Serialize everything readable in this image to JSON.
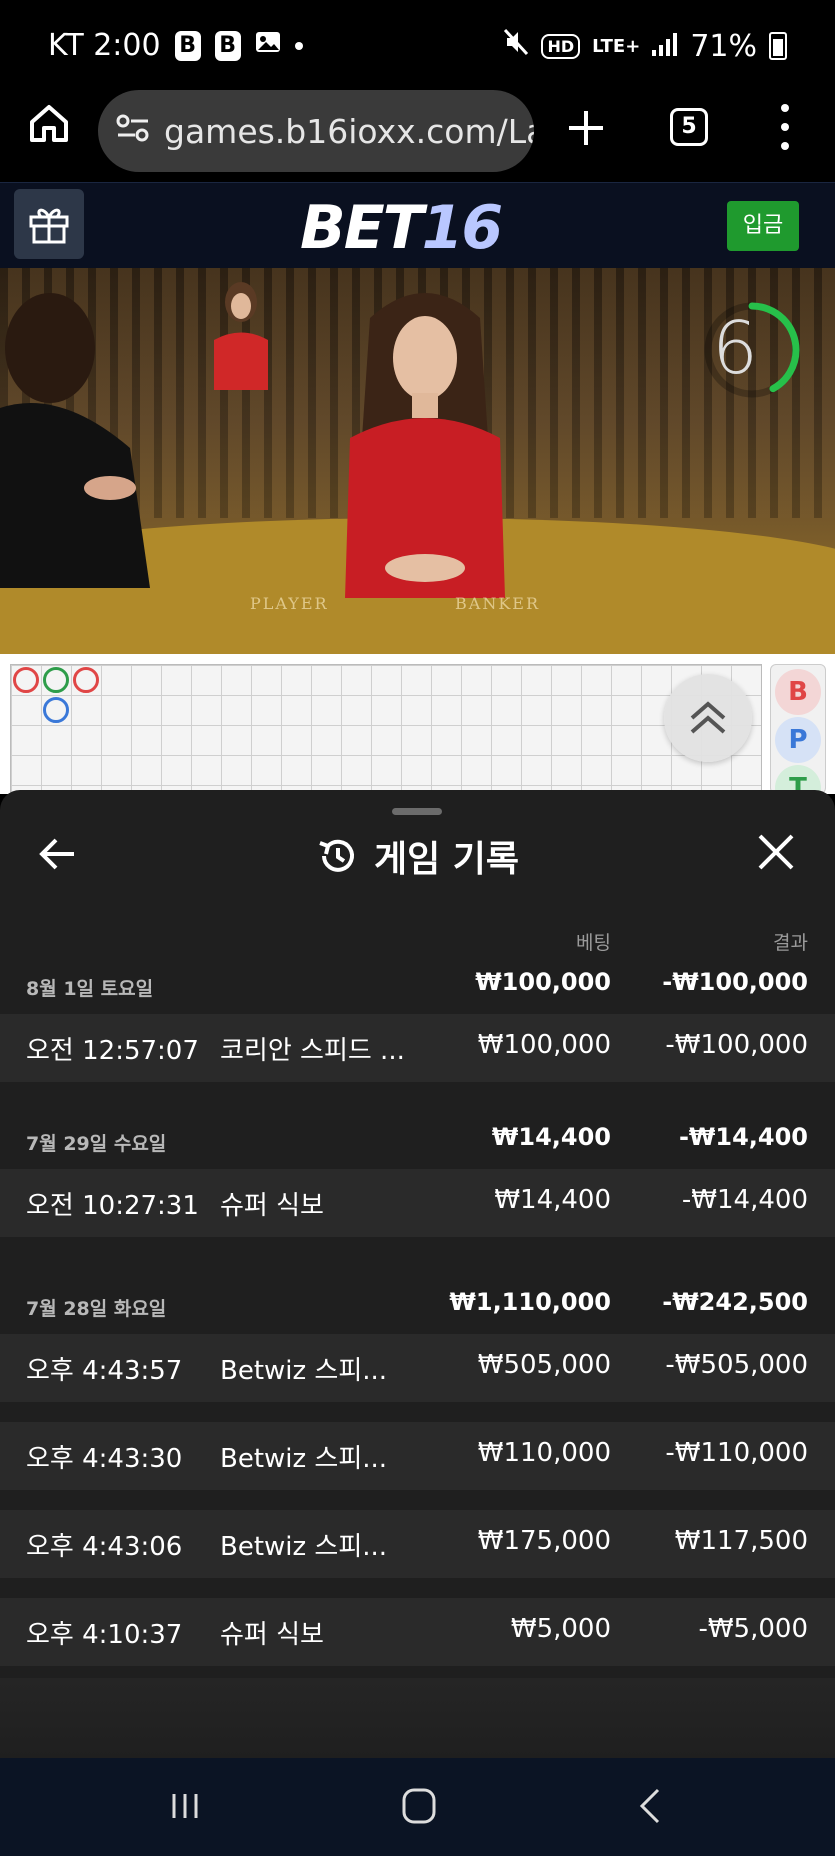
{
  "status_bar": {
    "carrier_time": "KT 2:00",
    "badge1": "B",
    "badge2": "B",
    "network": "LTE+",
    "hd": "HD",
    "battery": "71%"
  },
  "browser": {
    "url": "games.b16ioxx.com/La",
    "tab_count": "5"
  },
  "site": {
    "logo_part1": "BET",
    "logo_part2": "16",
    "deposit_label": "입금"
  },
  "video": {
    "timer": "6",
    "timer_progress": 0.42,
    "label_player": "PLAYER",
    "label_banker": "BANKER"
  },
  "road": {
    "chips": [
      "B",
      "P",
      "T"
    ],
    "colors": {
      "banker": "#e04646",
      "player": "#3a78d8",
      "tie": "#2e9d4a"
    }
  },
  "sheet": {
    "title": "게임 기록",
    "col_bet": "베팅",
    "col_result": "결과",
    "groups": [
      {
        "date": "8월 1일 토요일",
        "bet_total": "₩100,000",
        "result_total": "-₩100,000",
        "rows": [
          {
            "time": "오전 12:57:07",
            "game": "코리안 스피드 ...",
            "bet": "₩100,000",
            "result": "-₩100,000"
          }
        ]
      },
      {
        "date": "7월 29일 수요일",
        "bet_total": "₩14,400",
        "result_total": "-₩14,400",
        "rows": [
          {
            "time": "오전 10:27:31",
            "game": "슈퍼 식보",
            "bet": "₩14,400",
            "result": "-₩14,400"
          }
        ]
      },
      {
        "date": "7월 28일 화요일",
        "bet_total": "₩1,110,000",
        "result_total": "-₩242,500",
        "rows": [
          {
            "time": "오후 4:43:57",
            "game": "Betwiz 스피...",
            "bet": "₩505,000",
            "result": "-₩505,000"
          },
          {
            "time": "오후 4:43:30",
            "game": "Betwiz 스피...",
            "bet": "₩110,000",
            "result": "-₩110,000"
          },
          {
            "time": "오후 4:43:06",
            "game": "Betwiz 스피...",
            "bet": "₩175,000",
            "result": "₩117,500"
          },
          {
            "time": "오후 4:10:37",
            "game": "슈퍼 식보",
            "bet": "₩5,000",
            "result": "-₩5,000"
          }
        ]
      }
    ]
  }
}
